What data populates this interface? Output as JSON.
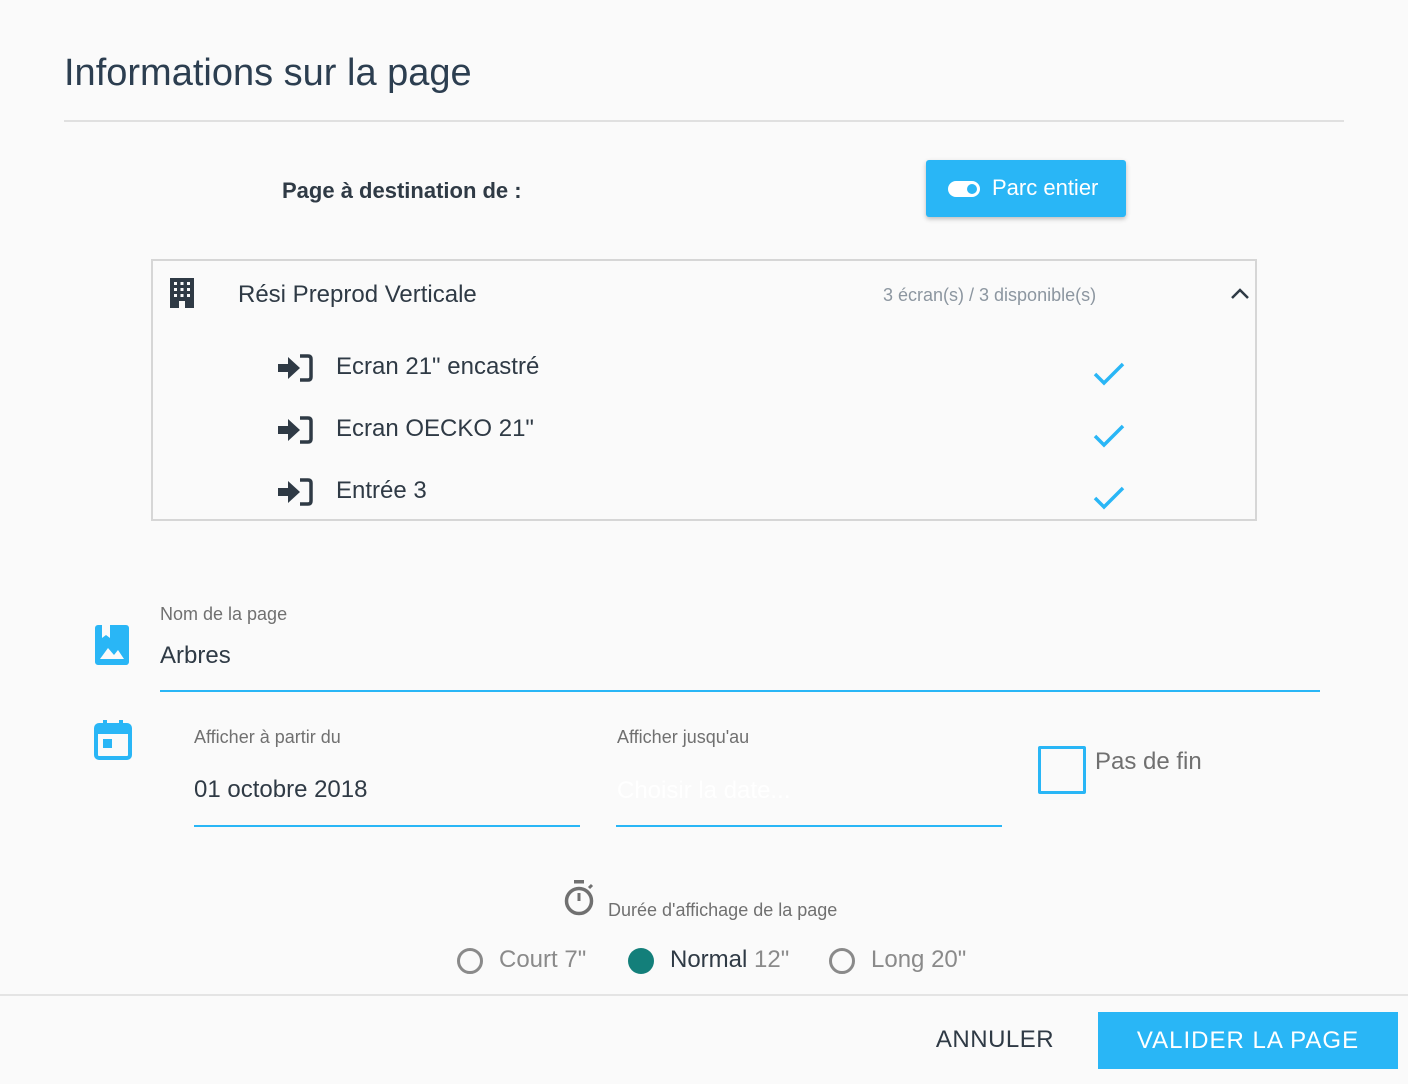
{
  "dialog": {
    "title": "Informations sur la page"
  },
  "destination": {
    "label": "Page à destination de :",
    "toggle_button_label": "Parc entier"
  },
  "site": {
    "name": "Rési Preprod Verticale",
    "count": "3 écran(s) / 3 disponible(s)",
    "screens": [
      {
        "label": "Ecran 21\" encastré",
        "selected": true
      },
      {
        "label": "Ecran OECKO 21\"",
        "selected": true
      },
      {
        "label": "Entrée 3",
        "selected": true
      }
    ]
  },
  "page_name": {
    "label": "Nom de la page",
    "value": "Arbres"
  },
  "dates": {
    "from_label": "Afficher à partir du",
    "from_value": "01 octobre 2018",
    "to_label": "Afficher jusqu'au",
    "to_placeholder": "Choisir la date...",
    "no_end_label": "Pas de fin",
    "no_end_checked": false
  },
  "duration": {
    "label": "Durée d'affichage de la page",
    "options": [
      {
        "name": "Court",
        "duration": "7\"",
        "selected": false
      },
      {
        "name": "Normal",
        "duration": "12\"",
        "selected": true
      },
      {
        "name": "Long",
        "duration": "20\"",
        "selected": false
      }
    ]
  },
  "footer": {
    "cancel_label": "ANNULER",
    "submit_label": "VALIDER LA PAGE"
  },
  "colors": {
    "accent": "#29b6f6",
    "radio_selected": "#137f7a",
    "text": "#2f3a45",
    "muted": "#707070"
  },
  "icons": {
    "site": "building-icon",
    "screen": "sign-in-icon",
    "selected": "check-icon",
    "collapse": "chevron-up-icon",
    "page": "image-bookmark-icon",
    "date": "calendar-icon",
    "duration": "timer-icon",
    "toggle": "toggle-on-icon"
  }
}
